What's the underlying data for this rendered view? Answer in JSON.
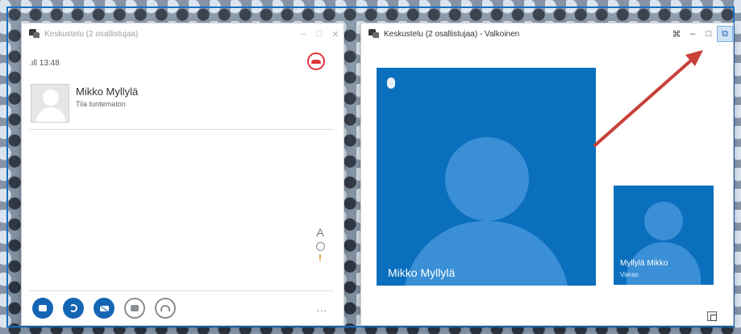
{
  "left_window": {
    "title": "Keskustelu (2 osallistujaa)",
    "controls": {
      "minimize": "–",
      "restore": "□",
      "close": "✕"
    },
    "signal_time": ".ıll 13:48",
    "contact": {
      "name": "Mikko Myllylä",
      "status": "Tila tuntematon"
    },
    "tools": {
      "font": "A",
      "important": "!"
    },
    "more": "..."
  },
  "right_window": {
    "title": "Keskustelu (2 osallistujaa) - Valkoinen",
    "controls": {
      "compact": "⌘",
      "minimize": "–",
      "restore": "□",
      "popout": "⧉"
    },
    "main_participant": "Mikko Myllylä",
    "self_view": {
      "name": "Myllylä Mikko",
      "role": "Vieras"
    }
  },
  "colors": {
    "stage_blue": "#0a6fbd",
    "silhouette_blue": "#3a8fd6",
    "end_call_red": "#e0333a",
    "action_blue": "#1565b5",
    "annotation_red": "#c8403a"
  }
}
